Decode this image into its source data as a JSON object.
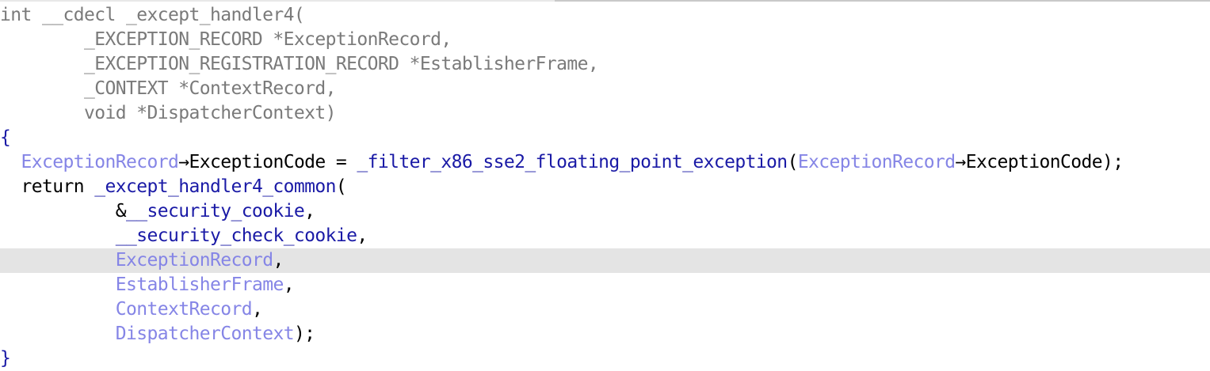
{
  "colors": {
    "background": "#ffffff",
    "highlight": "#e4e4e4",
    "keyword": "#4b4b6b",
    "muted": "#7a7a7a",
    "function": "#1a1aa6",
    "variable": "#8585e6",
    "plain": "#000000",
    "punct": "#1a1aa6"
  },
  "code": {
    "highlighted_line": 10,
    "lines": [
      {
        "tokens": [
          {
            "text": "int __cdecl _except_handler4(",
            "kind": "muted"
          }
        ]
      },
      {
        "tokens": [
          {
            "text": "        _EXCEPTION_RECORD *ExceptionRecord,",
            "kind": "muted"
          }
        ]
      },
      {
        "tokens": [
          {
            "text": "        _EXCEPTION_REGISTRATION_RECORD *EstablisherFrame,",
            "kind": "muted"
          }
        ]
      },
      {
        "tokens": [
          {
            "text": "        _CONTEXT *ContextRecord,",
            "kind": "muted"
          }
        ]
      },
      {
        "tokens": [
          {
            "text": "        void *DispatcherContext)",
            "kind": "muted"
          }
        ]
      },
      {
        "tokens": [
          {
            "text": "{",
            "kind": "punct"
          }
        ]
      },
      {
        "tokens": [
          {
            "text": "  ",
            "kind": "plain"
          },
          {
            "text": "ExceptionRecord",
            "kind": "variable"
          },
          {
            "text": "→ExceptionCode = ",
            "kind": "plain"
          },
          {
            "text": "_filter_x86_sse2_floating_point_exception",
            "kind": "function"
          },
          {
            "text": "(",
            "kind": "plain"
          },
          {
            "text": "ExceptionRecord",
            "kind": "variable"
          },
          {
            "text": "→ExceptionCode);",
            "kind": "plain"
          }
        ]
      },
      {
        "tokens": [
          {
            "text": "  return ",
            "kind": "plain"
          },
          {
            "text": "_except_handler4_common",
            "kind": "function"
          },
          {
            "text": "(",
            "kind": "plain"
          }
        ]
      },
      {
        "tokens": [
          {
            "text": "           &",
            "kind": "plain"
          },
          {
            "text": "__security_cookie",
            "kind": "function"
          },
          {
            "text": ",",
            "kind": "plain"
          }
        ]
      },
      {
        "tokens": [
          {
            "text": "           ",
            "kind": "plain"
          },
          {
            "text": "__security_check_cookie",
            "kind": "function"
          },
          {
            "text": ",",
            "kind": "plain"
          }
        ]
      },
      {
        "tokens": [
          {
            "text": "           ",
            "kind": "plain"
          },
          {
            "text": "ExceptionRecord",
            "kind": "variable"
          },
          {
            "text": ",",
            "kind": "plain"
          }
        ]
      },
      {
        "tokens": [
          {
            "text": "           ",
            "kind": "plain"
          },
          {
            "text": "EstablisherFrame",
            "kind": "variable"
          },
          {
            "text": ",",
            "kind": "plain"
          }
        ]
      },
      {
        "tokens": [
          {
            "text": "           ",
            "kind": "plain"
          },
          {
            "text": "ContextRecord",
            "kind": "variable"
          },
          {
            "text": ",",
            "kind": "plain"
          }
        ]
      },
      {
        "tokens": [
          {
            "text": "           ",
            "kind": "plain"
          },
          {
            "text": "DispatcherContext",
            "kind": "variable"
          },
          {
            "text": ");",
            "kind": "plain"
          }
        ]
      },
      {
        "tokens": [
          {
            "text": "}",
            "kind": "punct"
          }
        ]
      }
    ]
  }
}
